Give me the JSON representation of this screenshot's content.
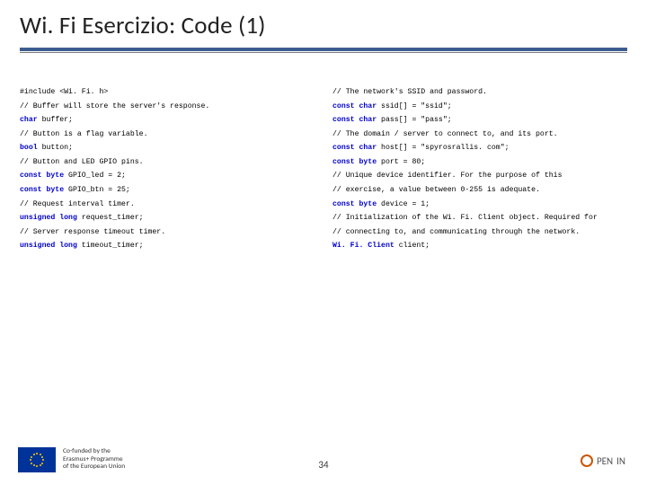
{
  "title": "Wi. Fi Esercizio: Code (1)",
  "left": {
    "l0_a": "#include ",
    "l0_b": "<Wi. Fi. h>",
    "l1": "// Buffer will store the server's response.",
    "l2_a": "char ",
    "l2_b": "buffer;",
    "l3": "// Button is a flag variable.",
    "l4_a": "bool ",
    "l4_b": "button;",
    "l5": "",
    "l6": "// Button and LED GPIO pins.",
    "l7_a": "const byte ",
    "l7_b": "GPIO_led = 2;",
    "l8_a": "const byte ",
    "l8_b": "GPIO_btn = 25;",
    "l9": "",
    "l10": "// Request interval timer.",
    "l11_a": "unsigned long ",
    "l11_b": "request_timer;",
    "l12": "// Server response timeout timer.",
    "l13_a": "unsigned long ",
    "l13_b": "timeout_timer;"
  },
  "right": {
    "r0": "// The network's SSID and password.",
    "r1_a": "const char ",
    "r1_b": "ssid[] = \"ssid\";",
    "r2_a": "const char ",
    "r2_b": "pass[] = \"pass\";",
    "r3": "",
    "r4": "// The domain / server to connect to, and its port.",
    "r5_a": "const char ",
    "r5_b": "host[] = \"spyrosrallis. com\";",
    "r6_a": "const byte ",
    "r6_b": "port   = 80;",
    "r7": "// Unique device identifier. For the purpose of this",
    "r8": "// exercise, a value between 0-255 is adequate.",
    "r9_a": "const byte ",
    "r9_b": "device = 1;",
    "r10": "// Initialization of the Wi. Fi. Client object. Required for",
    "r11": "// connecting to, and communicating through the network.",
    "r12_a": "Wi. Fi. Client ",
    "r12_b": "client;"
  },
  "footer": {
    "eu_line1": "Co-funded by the",
    "eu_line2": "Erasmus+ Programme",
    "eu_line3": "of the European Union",
    "page": "34",
    "logo1": "PEN",
    "logo2": "IN"
  }
}
